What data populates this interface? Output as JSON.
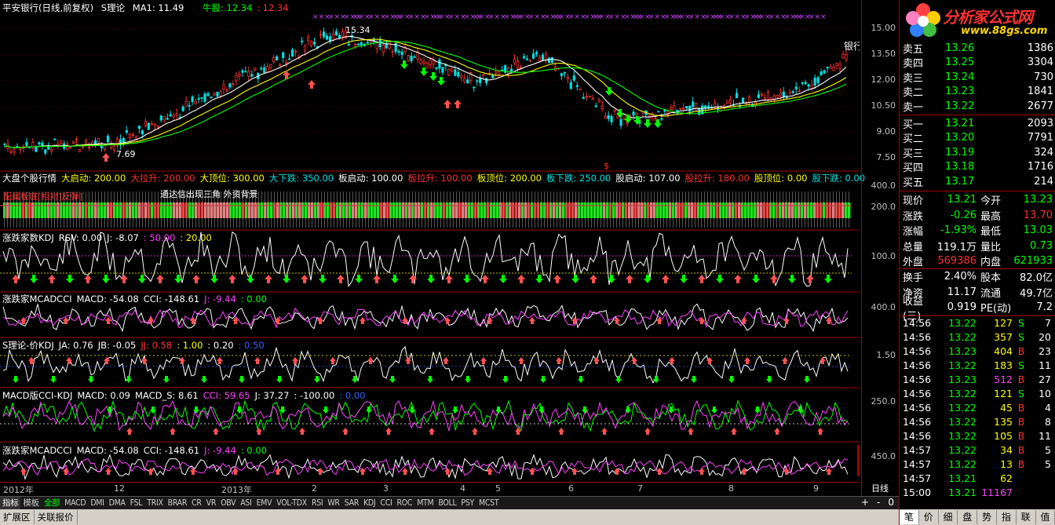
{
  "main_title": {
    "stock": "平安银行(日线,前复权)",
    "indicator": "S理论",
    "ma": "MA1: 11.49",
    "niu_label": "牛股: 12.34",
    "niu_val2": ": 12.34"
  },
  "main_chart": {
    "y_ticks": [
      "15.00",
      "13.50",
      "12.00",
      "10.50",
      "9.00",
      "7.50"
    ],
    "high_label": "15.34",
    "low_label": "7.69",
    "stock_tag": "银行",
    "dollar_mark": "$"
  },
  "panel2": {
    "title_parts": [
      {
        "text": "大盘个股行情",
        "color": "#ffffff"
      },
      {
        "text": "大启动: 200.00",
        "color": "#ffff00"
      },
      {
        "text": "大拉升: 200.00",
        "color": "#ff3030"
      },
      {
        "text": "大顶位: 300.00",
        "color": "#ffff00"
      },
      {
        "text": "大下跌: 350.00",
        "color": "#00e0e0"
      },
      {
        "text": "板启动: 100.00",
        "color": "#ffffff"
      },
      {
        "text": "板拉升: 100.00",
        "color": "#ff3030"
      },
      {
        "text": "板顶位: 200.00",
        "color": "#ffff00"
      },
      {
        "text": "板下跌: 250.00",
        "color": "#00e0e0"
      },
      {
        "text": "股启动: 107.00",
        "color": "#ffffff"
      },
      {
        "text": "股拉升: 180.00",
        "color": "#ff3030"
      },
      {
        "text": "股顶位: 0.00",
        "color": "#ffff00"
      },
      {
        "text": "股下跌: 0.00",
        "color": "#00e0e0"
      }
    ],
    "overlay_1": "配属板底[相对]反弹]",
    "overlay_2": "通达信出现三角 外资背景",
    "y_ticks": [
      "400.0",
      "200.0"
    ]
  },
  "panel3": {
    "title_parts": [
      {
        "text": "涨跌家数KDJ",
        "color": "#ffffff"
      },
      {
        "text": "RSV: 0.00",
        "color": "#ffffff"
      },
      {
        "text": "J: -8.07",
        "color": "#ffffff"
      },
      {
        "text": ": 50.00",
        "color": "#ff40ff"
      },
      {
        "text": ": 20.00",
        "color": "#ffff00"
      }
    ],
    "y_ticks": [
      "100.0"
    ]
  },
  "panel4": {
    "title_parts": [
      {
        "text": "涨跌家MCADCCI",
        "color": "#ffffff"
      },
      {
        "text": "MACD: -54.08",
        "color": "#ffffff"
      },
      {
        "text": "CCI: -148.61",
        "color": "#ffffff"
      },
      {
        "text": "J: -9.44",
        "color": "#ff40ff"
      },
      {
        "text": ": 0.00",
        "color": "#00ff00"
      }
    ],
    "y_ticks": [
      "400.0"
    ]
  },
  "panel5": {
    "title_parts": [
      {
        "text": "S理论-价KDJ",
        "color": "#ffffff"
      },
      {
        "text": "JA: 0.76",
        "color": "#ffffff"
      },
      {
        "text": "JB: -0.05",
        "color": "#ffffff"
      },
      {
        "text": "JJ: 0.58",
        "color": "#ff3030"
      },
      {
        "text": ": 1.00",
        "color": "#ffff00"
      },
      {
        "text": ": 0.20",
        "color": "#ffffff"
      },
      {
        "text": ": 0.50",
        "color": "#3060ff"
      }
    ],
    "y_ticks": [
      "1.50"
    ]
  },
  "panel6": {
    "title_parts": [
      {
        "text": "MACD版CCI-KDJ",
        "color": "#ffffff"
      },
      {
        "text": "MACD: 0.09",
        "color": "#ffffff"
      },
      {
        "text": "MACD_S: 8.61",
        "color": "#ffffff"
      },
      {
        "text": "CCI: 59.65",
        "color": "#ff40ff"
      },
      {
        "text": "J: 37.27",
        "color": "#ffffff"
      },
      {
        "text": ": -100.00",
        "color": "#ffffff"
      },
      {
        "text": ": 0.00",
        "color": "#3060ff"
      }
    ],
    "y_ticks": [
      "250.0"
    ]
  },
  "panel7": {
    "title_parts": [
      {
        "text": "涨跌家MCADCCI",
        "color": "#ffffff"
      },
      {
        "text": "MACD: -54.08",
        "color": "#ffffff"
      },
      {
        "text": "CCI: -148.61",
        "color": "#ffffff"
      },
      {
        "text": "J: -9.44",
        "color": "#ff40ff"
      },
      {
        "text": ": 0.00",
        "color": "#00ff00"
      }
    ],
    "y_ticks": [
      "450.0"
    ]
  },
  "date_axis": {
    "labels": [
      "2012年",
      "12",
      "2013年",
      "2",
      "3",
      "4",
      "5",
      "6",
      "7",
      "8",
      "9"
    ],
    "period": "日线"
  },
  "bottom_tabs": {
    "items": [
      "指标",
      "模板",
      "全部",
      "MACD",
      "DMI",
      "DMA",
      "FSL",
      "TRIX",
      "BRAR",
      "CR",
      "VR",
      "OBV",
      "ASI",
      "EMV",
      "VOL-TDX",
      "RSI",
      "WR",
      "SAR",
      "KDJ",
      "CCI",
      "ROC",
      "MTM",
      "BOLL",
      "PSY",
      "MCST"
    ],
    "zoom": [
      "+",
      "-",
      "0"
    ]
  },
  "status_bar": {
    "items": [
      "扩展区",
      "关联报价"
    ]
  },
  "logo": {
    "title": "分析家公式网",
    "url": "www.88gs.com"
  },
  "order_book": {
    "asks": [
      {
        "label": "卖五",
        "price": "13.26",
        "vol": "1386"
      },
      {
        "label": "卖四",
        "price": "13.25",
        "vol": "3304"
      },
      {
        "label": "卖三",
        "price": "13.24",
        "vol": "730"
      },
      {
        "label": "卖二",
        "price": "13.23",
        "vol": "1841"
      },
      {
        "label": "卖一",
        "price": "13.22",
        "vol": "2677"
      }
    ],
    "bids": [
      {
        "label": "买一",
        "price": "13.21",
        "vol": "2093"
      },
      {
        "label": "买二",
        "price": "13.20",
        "vol": "7791"
      },
      {
        "label": "买三",
        "price": "13.19",
        "vol": "324"
      },
      {
        "label": "买四",
        "price": "13.18",
        "vol": "1716"
      },
      {
        "label": "买五",
        "price": "13.17",
        "vol": "214"
      }
    ]
  },
  "stats": [
    {
      "l1": "现价",
      "v1": "13.21",
      "c1": "#00ff00",
      "l2": "今开",
      "v2": "13.23",
      "c2": "#00ff00"
    },
    {
      "l1": "涨跌",
      "v1": "-0.26",
      "c1": "#00ff00",
      "l2": "最高",
      "v2": "13.70",
      "c2": "#ff3030"
    },
    {
      "l1": "涨幅",
      "v1": "-1.93%",
      "c1": "#00ff00",
      "l2": "最低",
      "v2": "13.03",
      "c2": "#00ff00"
    },
    {
      "l1": "总量",
      "v1": "119.1万",
      "c1": "#ffffff",
      "l2": "量比",
      "v2": "0.73",
      "c2": "#00ff00"
    },
    {
      "l1": "外盘",
      "v1": "569386",
      "c1": "#ff3030",
      "l2": "内盘",
      "v2": "621933",
      "c2": "#00ff00"
    }
  ],
  "stats2": [
    {
      "l1": "换手",
      "v1": "2.40%",
      "l2": "股本",
      "v2": "82.0亿"
    },
    {
      "l1": "净资",
      "v1": "11.17",
      "l2": "流通",
      "v2": "49.7亿"
    },
    {
      "l1": "收益(三)",
      "v1": "0.919",
      "l2": "PE(动)",
      "v2": "7.2"
    }
  ],
  "ticks": [
    {
      "t": "14:56",
      "p": "13.22",
      "v": "127",
      "s": "S",
      "n": "7",
      "vc": "#ffff00",
      "sc": "#00ff00"
    },
    {
      "t": "14:56",
      "p": "13.22",
      "v": "357",
      "s": "S",
      "n": "20",
      "vc": "#ffff00",
      "sc": "#00ff00"
    },
    {
      "t": "14:56",
      "p": "13.23",
      "v": "404",
      "s": "B",
      "n": "23",
      "vc": "#ffff00",
      "sc": "#ff3030"
    },
    {
      "t": "14:56",
      "p": "13.22",
      "v": "183",
      "s": "S",
      "n": "11",
      "vc": "#ffff00",
      "sc": "#00ff00"
    },
    {
      "t": "14:56",
      "p": "13.23",
      "v": "512",
      "s": "B",
      "n": "27",
      "vc": "#ff40ff",
      "sc": "#ff3030"
    },
    {
      "t": "14:56",
      "p": "13.22",
      "v": "121",
      "s": "S",
      "n": "10",
      "vc": "#ffff00",
      "sc": "#00ff00"
    },
    {
      "t": "14:56",
      "p": "13.22",
      "v": "45",
      "s": "B",
      "n": "4",
      "vc": "#ffff00",
      "sc": "#ff3030"
    },
    {
      "t": "14:56",
      "p": "13.22",
      "v": "135",
      "s": "B",
      "n": "8",
      "vc": "#ffff00",
      "sc": "#ff3030"
    },
    {
      "t": "14:56",
      "p": "13.22",
      "v": "105",
      "s": "B",
      "n": "11",
      "vc": "#ffff00",
      "sc": "#ff3030"
    },
    {
      "t": "14:57",
      "p": "13.22",
      "v": "34",
      "s": "B",
      "n": "5",
      "vc": "#ffff00",
      "sc": "#ff3030"
    },
    {
      "t": "14:57",
      "p": "13.22",
      "v": "13",
      "s": "B",
      "n": "5",
      "vc": "#ffff00",
      "sc": "#ff3030"
    },
    {
      "t": "14:57",
      "p": "13.21",
      "v": "62",
      "s": "",
      "n": "",
      "vc": "#ffff00",
      "sc": "#ffffff"
    },
    {
      "t": "15:00",
      "p": "13.21",
      "v": "11167",
      "s": "",
      "n": "",
      "vc": "#ff40ff",
      "sc": "#ffffff"
    }
  ],
  "right_tabs": [
    "笔",
    "价",
    "细",
    "盘",
    "势",
    "指",
    "联",
    "值"
  ]
}
